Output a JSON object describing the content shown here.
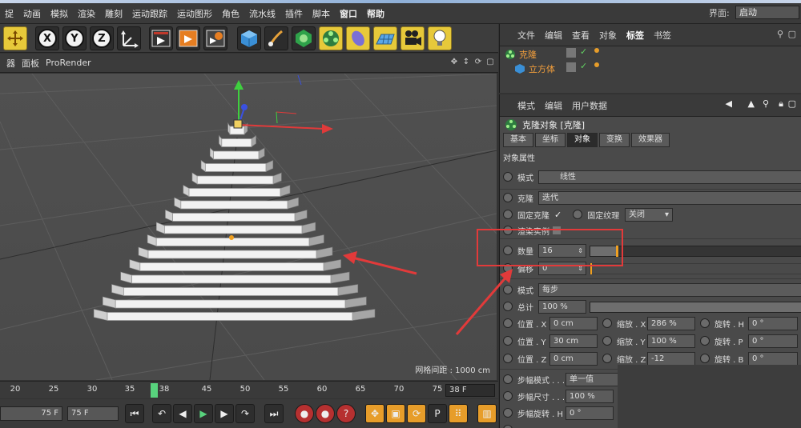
{
  "menu": {
    "items": [
      "捉",
      "动画",
      "模拟",
      "渲染",
      "雕刻",
      "运动跟踪",
      "运动图形",
      "角色",
      "流水线",
      "插件",
      "脚本",
      "窗口",
      "帮助"
    ],
    "layout_label": "界面:",
    "layout_value": "启动"
  },
  "toolbar": {
    "axis_x": "X",
    "axis_y": "Y",
    "axis_z": "Z"
  },
  "viewport": {
    "header_items": [
      "器",
      "面板",
      "ProRender"
    ],
    "grid_spacing": "网格间距 : 1000 cm"
  },
  "timeline": {
    "ticks": [
      "20",
      "25",
      "30",
      "35",
      "38",
      "45",
      "50",
      "55",
      "60",
      "65",
      "70",
      "75"
    ],
    "current_frame": "38",
    "end_frame_display": "38 F"
  },
  "transport": {
    "start_field": "75 F",
    "end_field": "75 F"
  },
  "object_manager": {
    "tabs": [
      "文件",
      "编辑",
      "查看",
      "对象",
      "标签",
      "书签"
    ],
    "selected_tab": "标签",
    "objects": [
      "克隆",
      "立方体"
    ]
  },
  "attribute_manager": {
    "tabs": [
      "模式",
      "编辑",
      "用户数据"
    ],
    "object_title": "克隆对象 [克隆]",
    "sub_tabs": [
      "基本",
      "坐标",
      "对象",
      "变换",
      "效果器"
    ],
    "selected_sub_tab": "对象",
    "section_title": "对象属性",
    "mode_label": "模式",
    "mode_value": "线性",
    "clone_label": "克隆",
    "clone_value": "迭代",
    "fix_clone_label": "固定克隆",
    "fix_texture_label": "固定纹理",
    "fix_texture_value": "关闭",
    "render_instance_label": "渲染实例",
    "count_label": "数量",
    "count_value": "16",
    "count_fraction": 0.13,
    "offset_label": "偏移",
    "offset_value": "0",
    "mode2_label": "模式",
    "mode2_value": "每步",
    "total_label": "总计",
    "total_value": "100 %",
    "pos_x_label": "位置 . X",
    "pos_x": "0 cm",
    "pos_y_label": "位置 . Y",
    "pos_y": "30 cm",
    "pos_z_label": "位置 . Z",
    "pos_z": "0 cm",
    "scale_x_label": "缩放 . X",
    "scale_x": "286 %",
    "scale_y_label": "缩放 . Y",
    "scale_y": "100 %",
    "scale_z_label": "缩放 . Z",
    "scale_z": "-12",
    "rot_h_label": "旋转 . H",
    "rot_h": "0 °",
    "rot_p_label": "旋转 . P",
    "rot_p": "0 °",
    "rot_b_label": "旋转 . B",
    "rot_b": "0 °",
    "step_mode_label": "步幅模式 . . .",
    "step_mode_value": "单一值",
    "step_size_label": "步幅尺寸 . . .",
    "step_size_value": "100 %",
    "step_rot_label": "步幅旋转 . H",
    "step_rot_value": "0 °"
  },
  "colors": {
    "highlight_box": "#e23a3a",
    "arrow": "#e23a3a",
    "object_name": "#f29e3c",
    "playhead": "#58d27d"
  }
}
